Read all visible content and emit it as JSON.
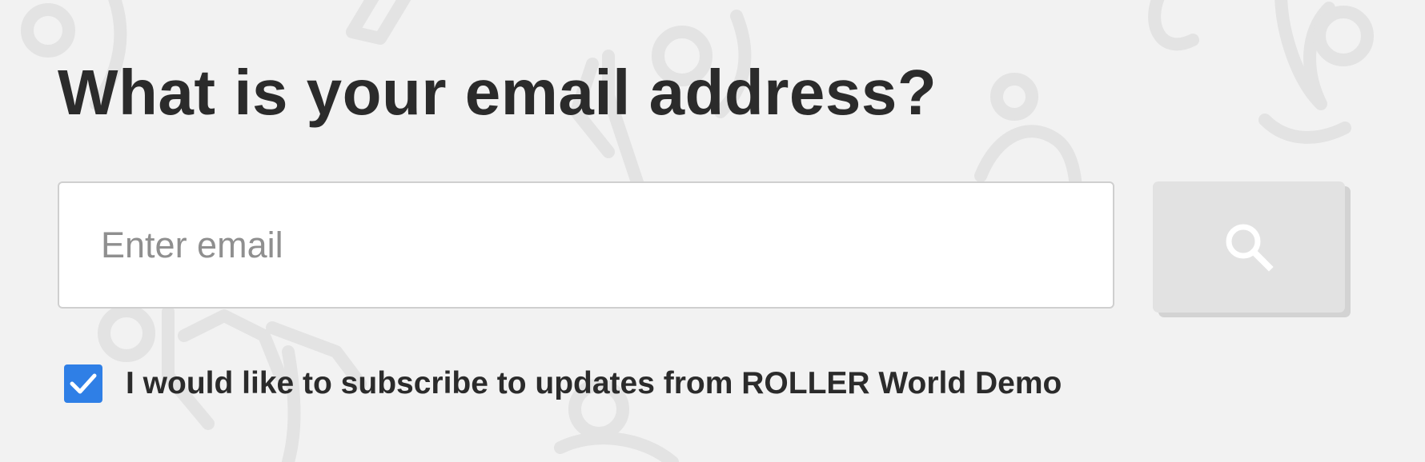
{
  "page": {
    "heading": "What is your email address?"
  },
  "email": {
    "value": "",
    "placeholder": "Enter email"
  },
  "search_button": {
    "icon": "search-icon",
    "aria_label": "Search"
  },
  "subscribe": {
    "checked": true,
    "label": "I would like to subscribe to updates from ROLLER World Demo"
  },
  "colors": {
    "background": "#f2f2f2",
    "pattern": "#e3e3e3",
    "heading_text": "#2b2b2b",
    "placeholder_text": "#8f8f8f",
    "button_bg": "#e2e2e2",
    "checkbox_accent": "#2f7fe6"
  }
}
